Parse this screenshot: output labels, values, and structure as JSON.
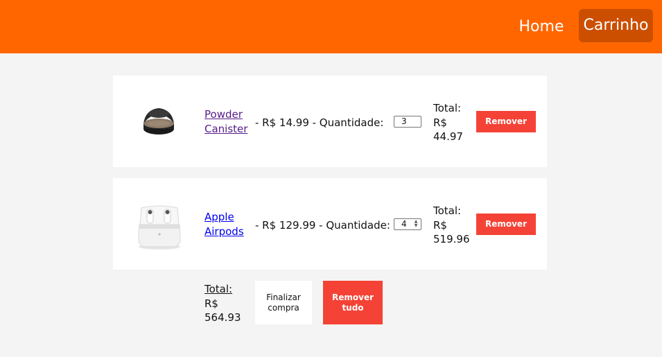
{
  "nav": {
    "home_label": "Home",
    "cart_label": "Carrinho"
  },
  "cart_items": [
    {
      "name": "Powder Canister",
      "price_text": "- R$ 14.99 - Quantidade:",
      "quantity": "3",
      "total_label": "Total:",
      "total_value": "R$ 44.97",
      "remove_label": "Remover",
      "image_icon": "powder-compact-image"
    },
    {
      "name": "Apple Airpods",
      "price_text": "- R$ 129.99 - Quantidade:",
      "quantity": "4",
      "total_label": "Total:",
      "total_value": "R$ 519.96",
      "remove_label": "Remover",
      "image_icon": "airpods-case-image"
    }
  ],
  "summary": {
    "total_label": "Total:",
    "total_value": "R$ 564.93",
    "finalize_label": "Finalizar compra",
    "remove_all_label": "Remover tudo"
  },
  "colors": {
    "navbar": "#ff6600",
    "nav_active": "#cc4f00",
    "remove_button": "#f44336",
    "background": "#f4f4f4"
  }
}
